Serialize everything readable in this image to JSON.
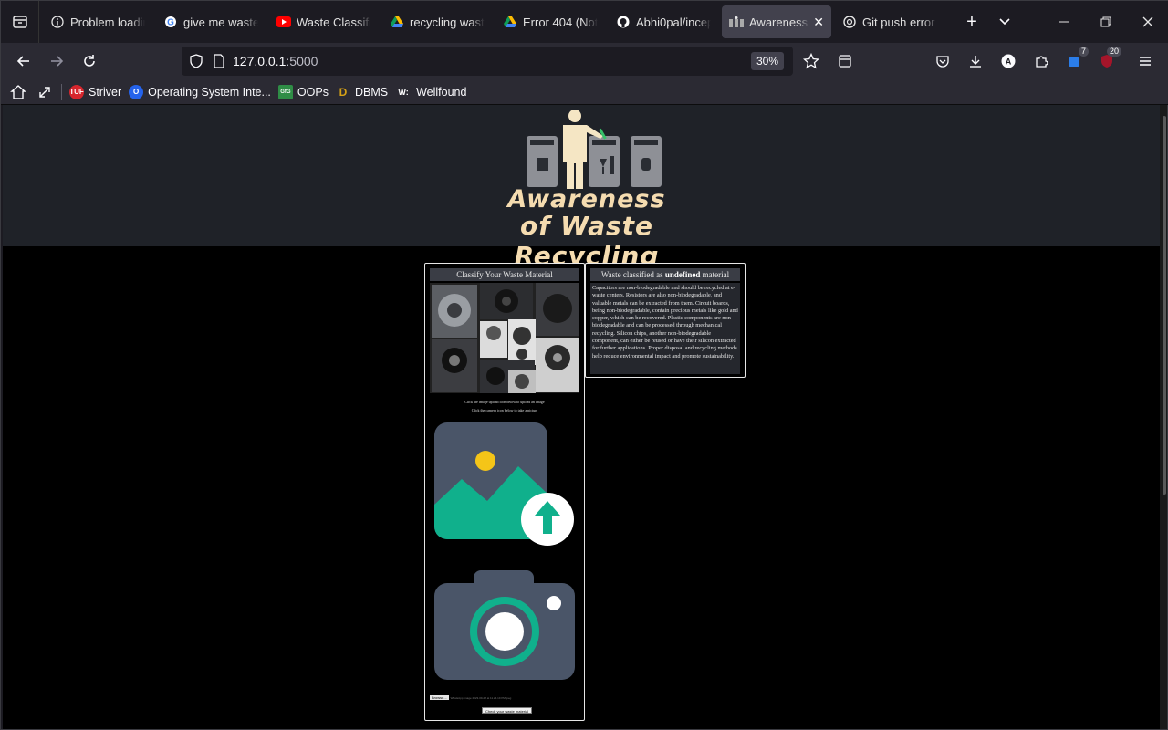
{
  "browser": {
    "tabs": [
      {
        "title": "Problem loadin",
        "icon": "info-icon",
        "active": false
      },
      {
        "title": "give me waste",
        "icon": "google-icon",
        "active": false
      },
      {
        "title": "Waste Classific",
        "icon": "youtube-icon",
        "active": false
      },
      {
        "title": "recycling waste",
        "icon": "drive-icon",
        "active": false
      },
      {
        "title": "Error 404 (Not",
        "icon": "drive-icon",
        "active": false
      },
      {
        "title": "Abhi0pal/incep",
        "icon": "github-icon",
        "active": false
      },
      {
        "title": "Awareness o",
        "icon": "site-favicon-icon",
        "active": true
      },
      {
        "title": "Git push error f",
        "icon": "openai-icon",
        "active": false
      }
    ],
    "url_host": "127.0.0.1",
    "url_port": ":5000",
    "zoom": "30%",
    "extension_badges": {
      "ext1": "7",
      "ext2": "20"
    },
    "bookmarks": [
      {
        "label": "Striver",
        "icon": "tuf-icon",
        "color": "#d7262d",
        "badge": "TUF"
      },
      {
        "label": "Operating System Inte...",
        "icon": "os-icon",
        "color": "#2563eb",
        "badge": "O"
      },
      {
        "label": "OOPs",
        "icon": "gfg-icon",
        "color": "#2f8d46",
        "badge": "GfG"
      },
      {
        "label": "DBMS",
        "icon": "dbms-icon",
        "color": "#d4a017",
        "badge": "D"
      },
      {
        "label": "Wellfound",
        "icon": "wellfound-icon",
        "color": "#000000",
        "badge": "W:"
      }
    ]
  },
  "site": {
    "logo_line1": "Awareness",
    "logo_line2": "of Waste Recycling",
    "classify_title": "Classify Your Waste Material",
    "hint_line1": "Click the image upload icon below to upload an image",
    "hint_line2": "Click the camera icon below to take a picture",
    "file_button": "Browse...",
    "file_name": "WhatsApp Image 2023-09-28 at 11.24.19 PM.jpeg",
    "check_button": "Check your waste material",
    "result_prefix": "Waste classified as ",
    "result_value": "undefined",
    "result_suffix": " material",
    "description": "Capacitors are non-biodegradable and should be recycled at e-waste centers. Resistors are also non-biodegradable, and valuable metals can be extracted from them. Circuit boards, being non-biodegradable, contain precious metals like gold and copper, which can be recovered. Plastic components are non-biodegradable and can be processed through mechanical recycling. Silicon chips, another non-biodegradable component, can either be reused or have their silicon extracted for further applications. Proper disposal and recycling methods help reduce environmental impact and promote sustainability."
  },
  "colors": {
    "hero_bg": "#1f2228",
    "logo_text": "#f5dcb0",
    "icon_slate": "#4a5568",
    "icon_teal": "#10b08c",
    "icon_sun": "#f5c518"
  }
}
